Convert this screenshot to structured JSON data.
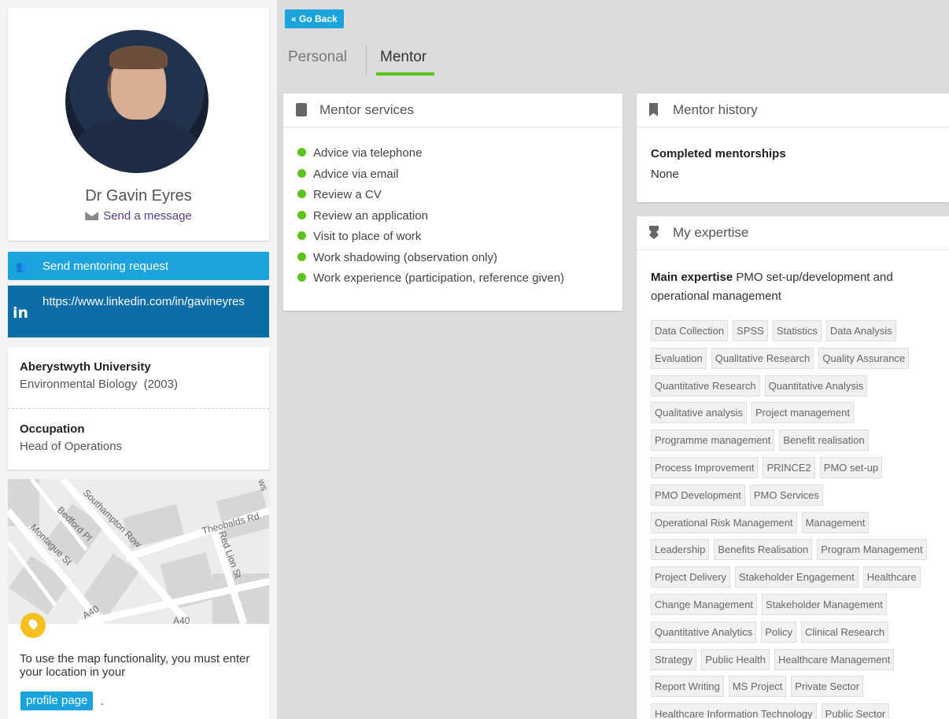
{
  "profile": {
    "name": "Dr Gavin Eyres",
    "send_message": "Send a message"
  },
  "actions": {
    "mentoring_request": "Send mentoring request",
    "linkedin_url": "https://www.linkedin.com/in/gavineyres"
  },
  "education": {
    "university": "Aberystwyth University",
    "course": "Environmental Biology",
    "year": "(2003)"
  },
  "occupation": {
    "label": "Occupation",
    "value": "Head of Operations"
  },
  "map": {
    "streets": [
      "Southampton Row",
      "Bedford Pl",
      "Montague St",
      "Theobalds Rd",
      "Red Lion St",
      "A40",
      "A40",
      "ws"
    ],
    "note": "To use the map functionality, you must enter your location in your",
    "profile_page_button": "profile page",
    "trailing": "."
  },
  "nav": {
    "go_back": "« Go Back",
    "tabs": [
      "Personal",
      "Mentor"
    ],
    "active_tab": "Mentor"
  },
  "services": {
    "title": "Mentor services",
    "items": [
      "Advice via telephone",
      "Advice via email",
      "Review a CV",
      "Review an application",
      "Visit to place of work",
      "Work shadowing (observation only)",
      "Work experience (participation, reference given)"
    ]
  },
  "history": {
    "title": "Mentor history",
    "completed_label": "Completed mentorships",
    "completed_value": "None"
  },
  "expertise": {
    "title": "My expertise",
    "main_label": "Main expertise",
    "main_value": "PMO set-up/development and operational management",
    "tag_rows": [
      [
        "Data Collection",
        "SPSS",
        "Statistics",
        "Data Analysis"
      ],
      [
        "Evaluation",
        "Qualitative Research",
        "Quality Assurance"
      ],
      [
        "Quantitative Research",
        "Quantitative Analysis"
      ],
      [
        "Qualitative analysis",
        "Project management"
      ],
      [
        "Programme management",
        "Benefit realisation"
      ],
      [
        "Process Improvement",
        "PRINCE2",
        "PMO set-up"
      ],
      [
        "PMO Development",
        "PMO Services"
      ],
      [
        "Operational Risk Management",
        "Management"
      ],
      [
        "Leadership",
        "Benefits Realisation",
        "Program Management"
      ],
      [
        "Project Delivery",
        "Stakeholder Engagement",
        "Healthcare"
      ],
      [
        "Change Management",
        "Stakeholder Management"
      ],
      [
        "Quantitative Analytics",
        "Policy",
        "Clinical Research"
      ],
      [
        "Strategy",
        "Public Health",
        "Healthcare Management"
      ],
      [
        "Report Writing",
        "MS Project",
        "Private Sector"
      ],
      [
        "Healthcare Information Technology",
        "Public Sector"
      ]
    ]
  },
  "colors": {
    "accent_blue": "#1aa3dc",
    "linkedin_blue": "#0d6da6",
    "green": "#5cc31a"
  }
}
